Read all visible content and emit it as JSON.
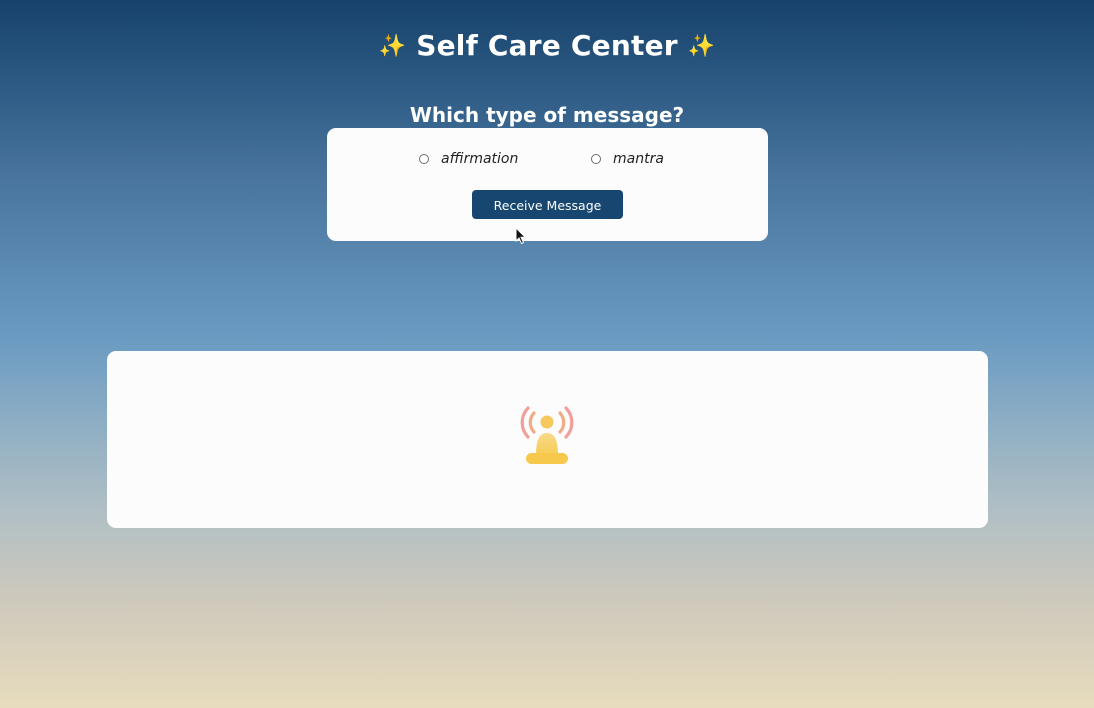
{
  "header": {
    "title": "Self Care Center",
    "sparkle_left": "✨",
    "sparkle_right": "✨"
  },
  "form": {
    "question": "Which type of message?",
    "options": [
      {
        "label": "affirmation",
        "selected": false
      },
      {
        "label": "mantra",
        "selected": false
      }
    ],
    "submit_label": "Receive Message"
  },
  "message_panel": {
    "icon": "meditation-icon",
    "message": ""
  },
  "colors": {
    "button": "#174770",
    "gradient_top": "#16426b",
    "gradient_middle": "#6b9bc2",
    "gradient_bottom": "#e7dcbd",
    "card": "#fcfcfc",
    "icon_body": "#f7d46a",
    "icon_waves": "#ef8e86"
  }
}
